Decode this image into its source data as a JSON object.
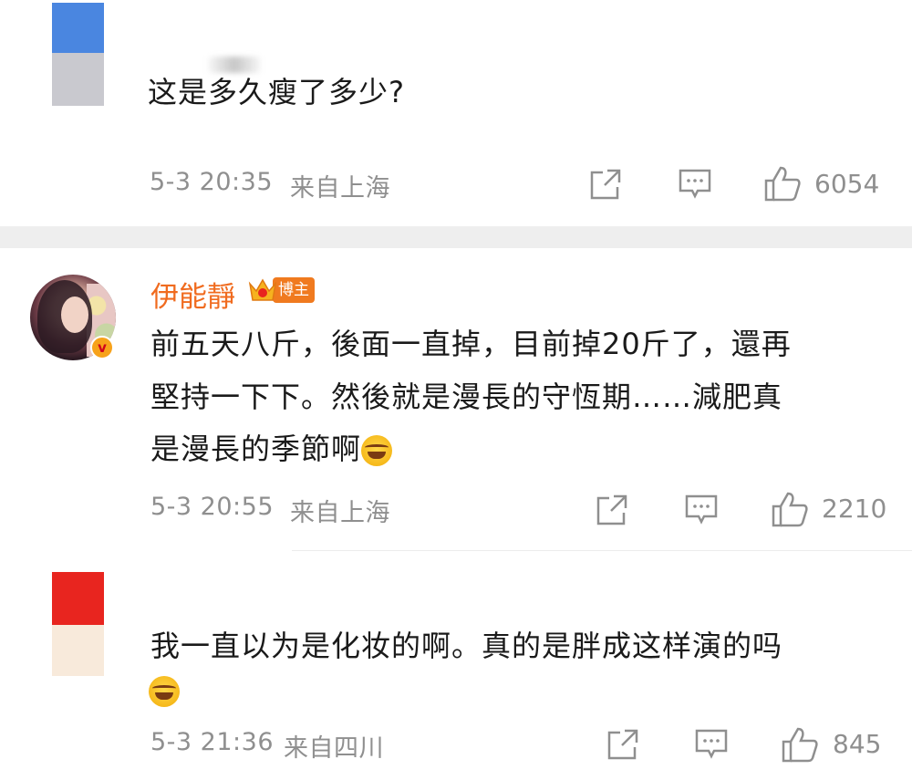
{
  "comments": [
    {
      "text": "这是多久瘦了多少?",
      "time": "5-3 20:35",
      "location": "来自上海",
      "likes": "6054",
      "avatar_colors": [
        "#4a86e0",
        "#c9c9cf"
      ]
    },
    {
      "username": "伊能靜",
      "badge": "博主",
      "line1": "前五天八斤，後面一直掉，目前掉20斤了，還再",
      "line2": "堅持一下下。然後就是漫長的守恆期……減肥真",
      "line3": "是漫長的季節啊",
      "time": "5-3 20:55",
      "location": "来自上海",
      "likes": "2210",
      "emoji_icon": "laugh-cry-icon",
      "username_color": "#f06b1f"
    },
    {
      "line1": "我一直以为是化妆的啊。真的是胖成这样演的吗",
      "time": "5-3 21:36",
      "location": "来自四川",
      "likes": "845",
      "emoji_icon": "laugh-cry-icon",
      "avatar_colors": [
        "#e8251f",
        "#f8eadb"
      ]
    }
  ]
}
